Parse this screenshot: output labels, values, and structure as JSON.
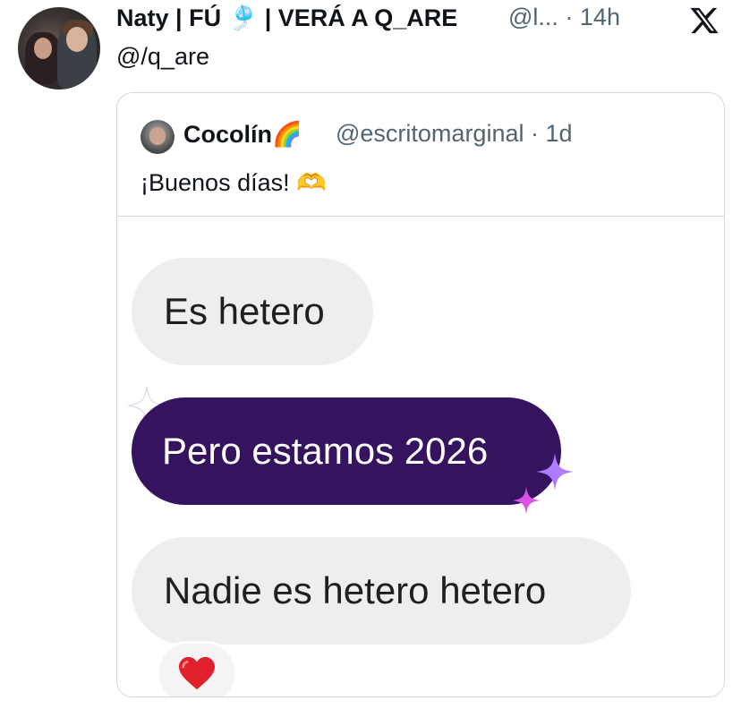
{
  "tweet": {
    "author_name": "Naty | FÚ 🎐 | VERÁ A Q_ARE",
    "author_handle_time": "@l... · 14h",
    "replying_to": "@/q_are"
  },
  "quoted": {
    "author_name": "Cocolín🌈",
    "author_handle_time": "@escritomarginal · 1d",
    "text": "¡Buenos días! 🫶",
    "media": {
      "bubbles": [
        "Es hetero",
        "Pero estamos 2026",
        "Nadie es hetero hetero"
      ],
      "reaction": "❤️"
    }
  },
  "icons": {
    "brand": "x-logo-icon",
    "sparkle": "sparkle-icon"
  },
  "colors": {
    "text": "#0f1419",
    "secondary": "#536471",
    "border": "#cfd9de",
    "purple_bubble": "#36135e",
    "gray_bubble": "#eeeeee"
  }
}
